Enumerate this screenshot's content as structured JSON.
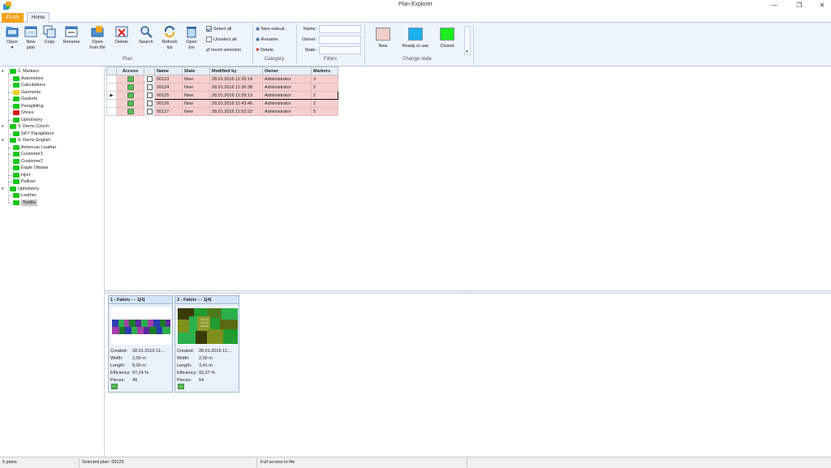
{
  "window": {
    "title": "Plan Explorer",
    "minimize": "—",
    "restore": "❐",
    "close": "✕"
  },
  "ribbon": {
    "app_tab": "PLAN",
    "tabs": [
      "Home"
    ],
    "plan_group": {
      "label": "Plan",
      "buttons": {
        "open": "Open",
        "new_plan_1": "New",
        "new_plan_2": "plan",
        "copy": "Copy",
        "rename": "Rename",
        "open_file_1": "Open",
        "open_file_2": "from file",
        "delete": "Delete",
        "search": "Search",
        "refresh_1": "Refresh",
        "refresh_2": "list",
        "open_bin_1": "Open",
        "open_bin_2": "bin"
      },
      "select_all": "Select all",
      "unselect_all": "Unselect all",
      "invert_selection": "Invert selection"
    },
    "category_group": {
      "label": "Category",
      "new_subcat": "New subcat.",
      "rename": "Rename",
      "delete": "Delete"
    },
    "filters_group": {
      "label": "Filters",
      "name_label": "Name:",
      "owner_label": "Owner:",
      "state_label": "State:",
      "name_value": "",
      "owner_value": "",
      "state_value": ""
    },
    "change_state_group": {
      "label": "Change state",
      "states": [
        {
          "label": "New",
          "color": "#f4cdc6"
        },
        {
          "label": "Ready to use",
          "color": "#1ab2f0"
        },
        {
          "label": "Closed",
          "color": "#1cf01c"
        }
      ]
    }
  },
  "tree": {
    "nodes": [
      {
        "label": "1. Markers",
        "level": 0,
        "expander": "▾",
        "folder": "green"
      },
      {
        "label": "Automotive",
        "level": 1,
        "folder": "green"
      },
      {
        "label": "Calculations",
        "level": 1,
        "folder": "green"
      },
      {
        "label": "Garments",
        "level": 1,
        "folder": "yellow"
      },
      {
        "label": "Gaskets",
        "level": 1,
        "folder": "green"
      },
      {
        "label": "Paragliding",
        "level": 1,
        "folder": "green"
      },
      {
        "label": "Shoes",
        "level": 1,
        "folder": "red"
      },
      {
        "label": "Upholstery",
        "level": 1,
        "folder": "green"
      },
      {
        "label": "3. Demo Czech",
        "level": 0,
        "expander": "▾",
        "folder": "green"
      },
      {
        "label": "SKY Paragliders",
        "level": 1,
        "folder": "green"
      },
      {
        "label": "4. Demo English",
        "level": 0,
        "expander": "▾",
        "folder": "green"
      },
      {
        "label": "American Leather",
        "level": 1,
        "folder": "green"
      },
      {
        "label": "Customer1",
        "level": 1,
        "folder": "green"
      },
      {
        "label": "Customer2",
        "level": 1,
        "folder": "green"
      },
      {
        "label": "Eagle Ottawa",
        "level": 1,
        "folder": "green"
      },
      {
        "label": "Hjort",
        "level": 1,
        "folder": "green"
      },
      {
        "label": "Palliser",
        "level": 1,
        "folder": "green"
      },
      {
        "label": "Upholstery",
        "level": 0,
        "expander": "▾",
        "folder": "green"
      },
      {
        "label": "Leather",
        "level": 1,
        "folder": "green"
      },
      {
        "label": "Textile",
        "level": 1,
        "folder": "green",
        "selected": true
      }
    ]
  },
  "grid": {
    "columns": [
      "Access",
      "",
      "Name",
      "State",
      "Modified by",
      "Owner",
      "Markers"
    ],
    "current_marker": "▶",
    "rows": [
      {
        "name": "00123",
        "state": "New",
        "modified": "28.01.2016 11:35:14",
        "owner": "Administrator",
        "markers": "3"
      },
      {
        "name": "00124",
        "state": "New",
        "modified": "28.01.2016 11:36:38",
        "owner": "Administrator",
        "markers": "2"
      },
      {
        "name": "00125",
        "state": "New",
        "modified": "28.01.2016 11:39:13",
        "owner": "Administrator",
        "markers": "2",
        "current": true
      },
      {
        "name": "00126",
        "state": "New",
        "modified": "28.01.2016 11:43:46",
        "owner": "Administrator",
        "markers": "2"
      },
      {
        "name": "00127",
        "state": "New",
        "modified": "28.01.2016 11:52:22",
        "owner": "Administrator",
        "markers": "5"
      }
    ]
  },
  "cards": [
    {
      "title": "1 - Fabric -  - 1[4]",
      "created_label": "Created:",
      "created": "28.01.2016 11:...",
      "width_label": "Width:",
      "width": "2,00 m",
      "length_label": "Length:",
      "length": "8,00 m",
      "efficiency_label": "Efficiency:",
      "efficiency": "97,24 %",
      "pieces_label": "Pieces:",
      "pieces": "49"
    },
    {
      "title": "2 - Fabric -  - 1[4]",
      "created_label": "Created:",
      "created": "28.01.2016 11:...",
      "width_label": "Width:",
      "width": "2,00 m",
      "length_label": "Length:",
      "length": "3,41 m",
      "efficiency_label": "Efficiency:",
      "efficiency": "93,37 %",
      "pieces_label": "Pieces:",
      "pieces": "54"
    }
  ],
  "status": {
    "plans": "5 plans",
    "selected_plan": "Selected plan: 00125",
    "access": "Full access to file"
  }
}
